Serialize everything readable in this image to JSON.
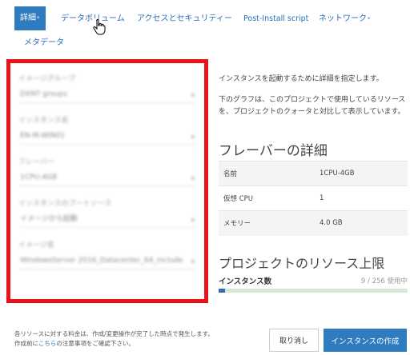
{
  "tabs": [
    {
      "label": "詳細",
      "required": true,
      "active": true
    },
    {
      "label": "データボリューム",
      "required": false,
      "active": false
    },
    {
      "label": "アクセスとセキュリティー",
      "required": false,
      "active": false
    },
    {
      "label": "Post-Install script",
      "required": false,
      "active": false
    },
    {
      "label": "ネットワーク",
      "required": true,
      "active": false
    },
    {
      "label": "メタデータ",
      "required": false,
      "active": false
    }
  ],
  "required_mark": "*",
  "form": {
    "fields": [
      {
        "label": "イメージグループ",
        "value": "DXNT groups"
      },
      {
        "label": "インスタンス名",
        "value": "EN-M-WIN01"
      },
      {
        "label": "フレーバー",
        "value": "1CPU-4GB"
      },
      {
        "label": "インスタンスのブートソース",
        "value": "イメージから起動"
      },
      {
        "label": "イメージ名",
        "value": "WindowsServer 2016_Datacenter_64_include"
      }
    ]
  },
  "description": {
    "line1": "インスタンスを起動するために詳細を指定します。",
    "line2": "下のグラフは、このプロジェクトで使用しているリソースを、プロジェクトのクォータと対比して表示しています。"
  },
  "flavor": {
    "title": "フレーバーの詳細",
    "rows": [
      {
        "name": "名前",
        "value": "1CPU-4GB"
      },
      {
        "name": "仮想 CPU",
        "value": "1"
      },
      {
        "name": "メモリー",
        "value": "4.0 GB"
      }
    ]
  },
  "resources": {
    "title": "プロジェクトのリソース上限",
    "instances_label": "インスタンス数",
    "instances_usage": "9 / 256 使用中",
    "instances_fraction": 0.035
  },
  "footer": {
    "note_line1": "各リソースに対する料金は、作成/変更操作が完了した時点で発生します。",
    "note_line2_pre": "作成前に",
    "note_link": "こちら",
    "note_line2_post": "の注意事項をご確認下さい。",
    "cancel": "取り消し",
    "create": "インスタンスの作成"
  },
  "colors": {
    "accent": "#2f7bbf",
    "highlight_border": "#e8141c"
  }
}
